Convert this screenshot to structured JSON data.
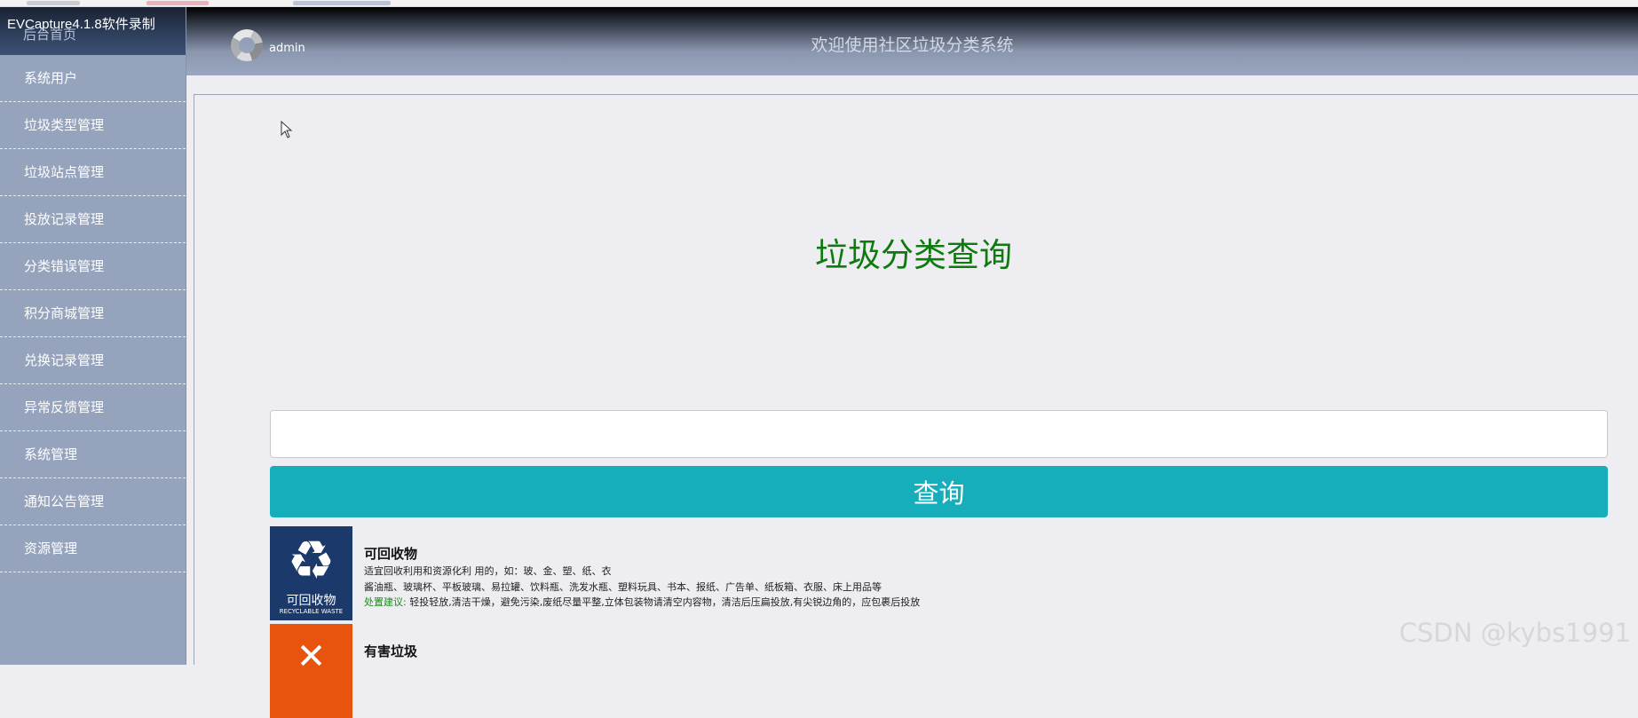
{
  "recorder_label": "EVCapture4.1.8软件录制",
  "sidebar": {
    "home_label": "后台首页",
    "items": [
      {
        "label": "系统用户"
      },
      {
        "label": "垃圾类型管理"
      },
      {
        "label": "垃圾站点管理"
      },
      {
        "label": "投放记录管理"
      },
      {
        "label": "分类错误管理"
      },
      {
        "label": "积分商城管理"
      },
      {
        "label": "兑换记录管理"
      },
      {
        "label": "异常反馈管理"
      },
      {
        "label": "系统管理"
      },
      {
        "label": "通知公告管理"
      },
      {
        "label": "资源管理"
      }
    ]
  },
  "header": {
    "username": "admin",
    "welcome": "欢迎使用社区垃圾分类系统"
  },
  "main": {
    "title": "垃圾分类查询",
    "search": {
      "value": "",
      "placeholder": ""
    },
    "search_button": "查询",
    "categories": [
      {
        "name": "可回收物",
        "icon_text_cn": "可回收物",
        "icon_text_en": "RECYCLABLE WASTE",
        "desc": "适宜回收利用和资源化利 用的，如：玻、金、塑、纸、衣",
        "examples": "酱油瓶、玻璃杯、平板玻璃、易拉罐、饮料瓶、洗发水瓶、塑料玩具、书本、报纸、广告单、纸板箱、衣服、床上用品等",
        "advice_label": "处置建议:",
        "advice": "轻投轻放,清洁干燥，避免污染,废纸尽量平整,立体包装物请清空内容物，清洁后压扁投放,有尖锐边角的，应包裹后投放"
      },
      {
        "name": "有害垃圾"
      }
    ]
  },
  "watermark": "CSDN @kybs1991",
  "colors": {
    "sidebar_bg": "#96a3bd",
    "title_green": "#0f7a10",
    "button_teal": "#16aebb",
    "recycle_blue": "#1b3a6b",
    "hazard_orange": "#e8530e"
  }
}
